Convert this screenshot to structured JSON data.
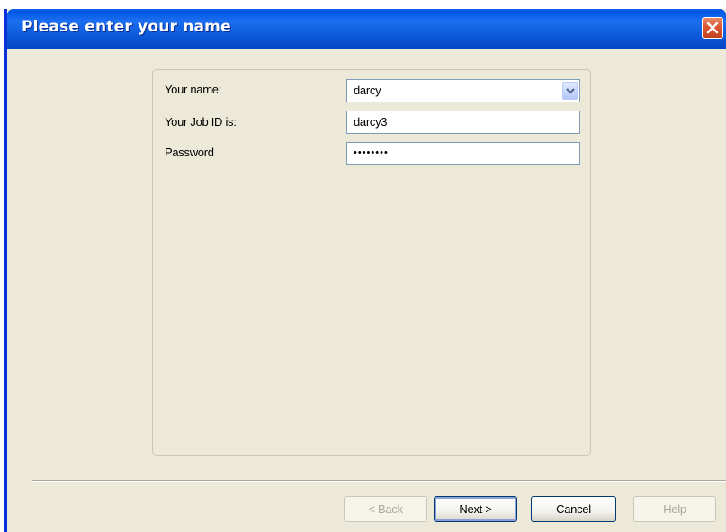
{
  "window": {
    "title": "Please enter your name"
  },
  "form": {
    "name_label": "Your name:",
    "name_value": "darcy",
    "jobid_label": "Your Job ID is:",
    "jobid_value": "darcy3",
    "password_label": "Password",
    "password_mask": "••••••••"
  },
  "buttons": {
    "back": "< Back",
    "next": "Next >",
    "cancel": "Cancel",
    "help": "Help"
  },
  "colors": {
    "titlebar": "#0058e6",
    "dialog_bg": "#ece9d8",
    "close_button": "#d9532f"
  }
}
